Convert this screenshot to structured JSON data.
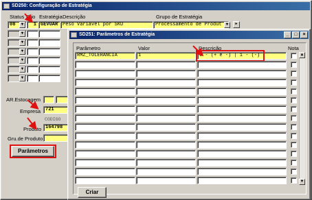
{
  "win1": {
    "title": "SD250: Configuração de Estratégia",
    "headers": {
      "status": "Status",
      "prio": "Prio",
      "estrategia": "Estratégia",
      "descricao": "Descrição",
      "grupo": "Grupo de Estratégia"
    },
    "row1": {
      "status": "08",
      "prio": "1",
      "estrategia": "GEVUAR",
      "descricao": "Peso Variável por SKU",
      "grupo": "Processamento de Produt"
    },
    "ar_estocagem_label": "AR.Estocagem",
    "empresa_label": "Empresa",
    "empresa_value": "721",
    "codigo_label": "CODIGO",
    "produto_label": "Produto",
    "produto_value": "164798",
    "gru_produto_label": "Gru.de Produto",
    "parametros_button": "Parâmetros"
  },
  "win2": {
    "title": "SD251: Parâmetros de Estratégia",
    "headers": {
      "parametro": "Parâmetro",
      "valor": "Valor",
      "descricao": "Descrição",
      "nota": "Nota"
    },
    "row1": {
      "parametro": "RMZ_TOLERANCIA",
      "valor": "1",
      "descricao": "0 - (+ e -) | 1 - (-)"
    },
    "criar_button": "Criar"
  },
  "colors": {
    "highlight_yellow": "#ffff80",
    "annotation_red": "#e01010",
    "title_blue": "#0a246a"
  }
}
